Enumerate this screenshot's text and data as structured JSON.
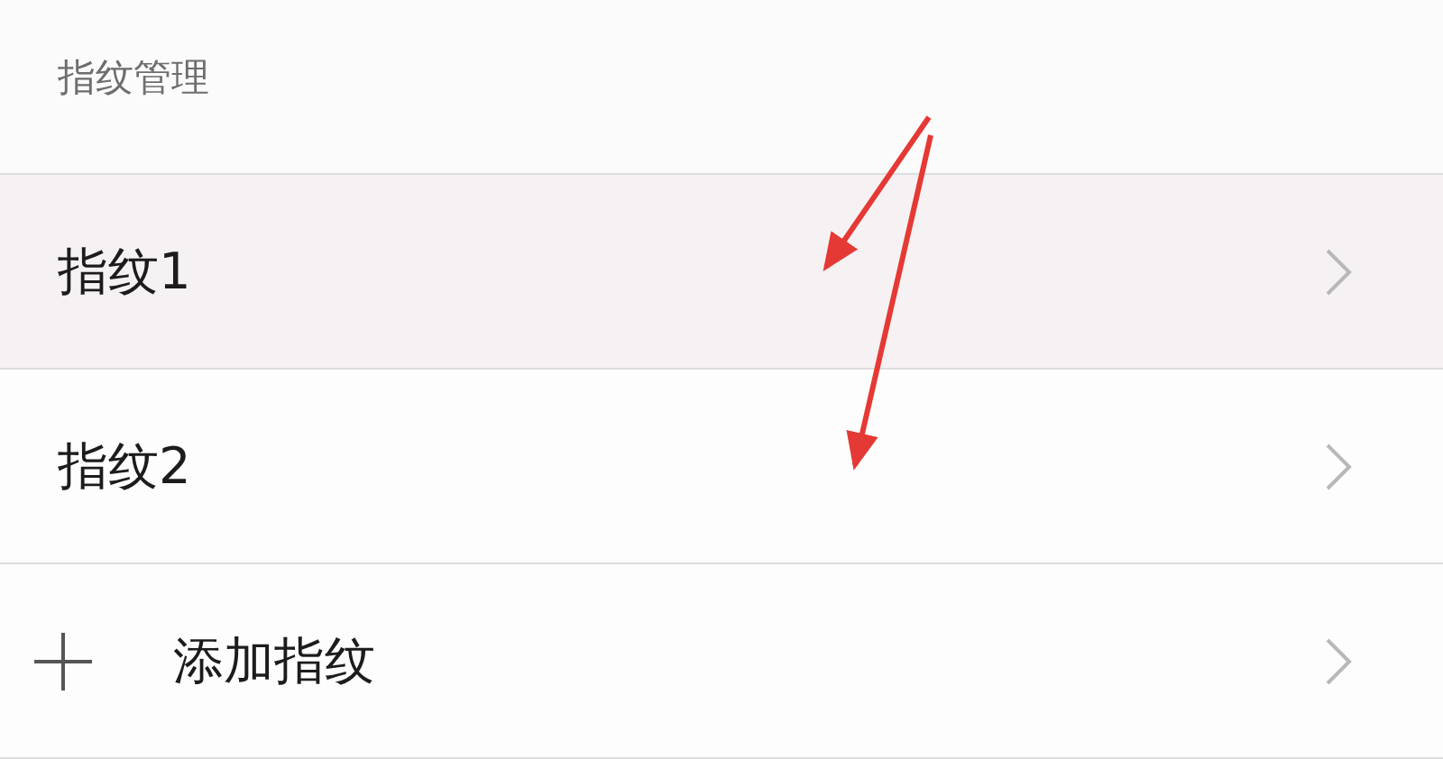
{
  "header": "指纹管理",
  "items": [
    {
      "kind": "entry",
      "label": "指纹1",
      "selected": true
    },
    {
      "kind": "entry",
      "label": "指纹2",
      "selected": false
    },
    {
      "kind": "add",
      "label": "添加指纹",
      "selected": false
    }
  ]
}
